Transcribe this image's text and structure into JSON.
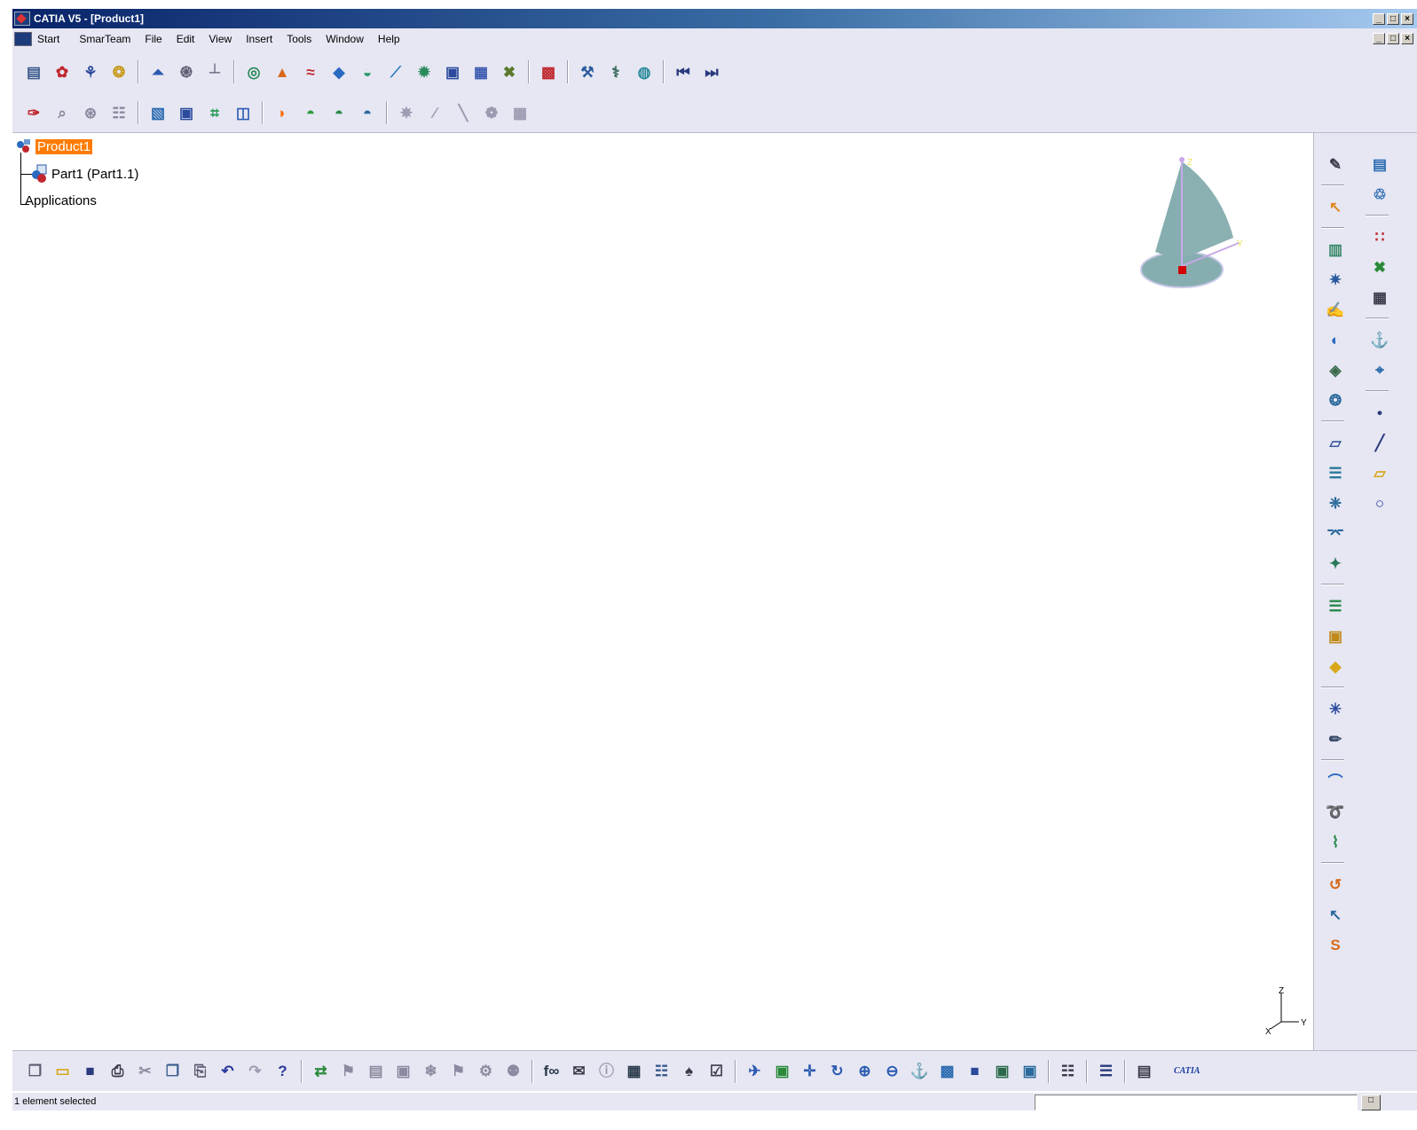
{
  "window": {
    "title": "CATIA V5 - [Product1]",
    "controls": [
      "_",
      "□",
      "×"
    ]
  },
  "menubar": {
    "items": [
      "Start",
      "SmarTeam",
      "File",
      "Edit",
      "View",
      "Insert",
      "Tools",
      "Window",
      "Help"
    ]
  },
  "toolbar_row1": [
    {
      "name": "catalog-icon",
      "glyph": "▤",
      "color": "#3a5a8c"
    },
    {
      "name": "select-all-icon",
      "glyph": "✿",
      "color": "#c0282e"
    },
    {
      "name": "product-icon",
      "glyph": "⚘",
      "color": "#2a4a9c"
    },
    {
      "name": "replace-icon",
      "glyph": "❂",
      "color": "#c89a1a"
    },
    {
      "name": "up-arrow-icon",
      "glyph": "⏶",
      "color": "#2a5ab0"
    },
    {
      "name": "spiral-icon",
      "glyph": "֎",
      "color": "#5a5a70"
    },
    {
      "name": "axis-system-icon",
      "glyph": "┴",
      "color": "#5a5a70"
    },
    {
      "name": "extrude-icon",
      "glyph": "◎",
      "color": "#2a8a5a"
    },
    {
      "name": "revolve-icon",
      "glyph": "▲",
      "color": "#d86a1a"
    },
    {
      "name": "sweep-icon",
      "glyph": "≈",
      "color": "#c0282e"
    },
    {
      "name": "fill-icon",
      "glyph": "◆",
      "color": "#2a6ac0"
    },
    {
      "name": "loft-icon",
      "glyph": "◒",
      "color": "#2a9a6a"
    },
    {
      "name": "blend-icon",
      "glyph": "⟋",
      "color": "#2a7ac0"
    },
    {
      "name": "offset-icon",
      "glyph": "✹",
      "color": "#2a8a5a"
    },
    {
      "name": "join-icon",
      "glyph": "▣",
      "color": "#2a4a9c"
    },
    {
      "name": "split-icon",
      "glyph": "▦",
      "color": "#3a5ab0"
    },
    {
      "name": "trim-icon",
      "glyph": "✖",
      "color": "#5a7a2a"
    },
    {
      "name": "measure-icon",
      "glyph": "▩",
      "color": "#c0282e"
    },
    {
      "name": "analysis-icon",
      "glyph": "⚒",
      "color": "#2a5a9c"
    },
    {
      "name": "knowledge-icon",
      "glyph": "⚕",
      "color": "#3a6a5a"
    },
    {
      "name": "globe-icon",
      "glyph": "◍",
      "color": "#2a8a9a"
    },
    {
      "name": "first-icon",
      "glyph": "⏮",
      "color": "#2a3a7c"
    },
    {
      "name": "last-icon",
      "glyph": "⏭",
      "color": "#2a3a7c"
    }
  ],
  "toolbar_row2": [
    {
      "name": "sketch-icon",
      "glyph": "✑",
      "color": "#c0282e"
    },
    {
      "name": "projection-icon",
      "glyph": "⌕",
      "color": "#8a8aa0"
    },
    {
      "name": "intersection-icon",
      "glyph": "⊛",
      "color": "#8a8aa0"
    },
    {
      "name": "boundary-icon",
      "glyph": "☷",
      "color": "#8a8aa0"
    },
    {
      "name": "view-mode-1-icon",
      "glyph": "▧",
      "color": "#2a6ab0"
    },
    {
      "name": "view-mode-2-icon",
      "glyph": "▣",
      "color": "#2a4a9c"
    },
    {
      "name": "mesh-icon",
      "glyph": "⌗",
      "color": "#2a9a5a"
    },
    {
      "name": "panel-icon",
      "glyph": "◫",
      "color": "#2a5ab0"
    },
    {
      "name": "dome-orange-icon",
      "glyph": "◗",
      "color": "#ff6a00"
    },
    {
      "name": "dome-green-icon",
      "glyph": "◓",
      "color": "#2a9a3a"
    },
    {
      "name": "dome-green-2-icon",
      "glyph": "◓",
      "color": "#2a8a4a"
    },
    {
      "name": "dome-outline-icon",
      "glyph": "◓",
      "color": "#2a6a9a"
    },
    {
      "name": "scatter-icon",
      "glyph": "✵",
      "color": "#9a9ab0"
    },
    {
      "name": "curve-icon",
      "glyph": "∕",
      "color": "#9a9ab0"
    },
    {
      "name": "polyline-icon",
      "glyph": "╲",
      "color": "#9a9ab0"
    },
    {
      "name": "cloud-icon",
      "glyph": "❁",
      "color": "#9a9ab0"
    },
    {
      "name": "grid-icon",
      "glyph": "▦",
      "color": "#9a9ab0"
    }
  ],
  "tree": {
    "root": "Product1",
    "child": "Part1 (Part1.1)",
    "applications": "Applications"
  },
  "compass_labels": {
    "z": "Z",
    "y": "Y"
  },
  "axis_labels": {
    "z": "Z",
    "y": "Y",
    "x": "X"
  },
  "right_col1": [
    {
      "name": "sketcher-icon",
      "glyph": "✎",
      "color": "#3a3a4a"
    },
    {
      "name": "select-icon",
      "glyph": "↖",
      "color": "#e08a1a"
    },
    {
      "name": "wireframe-icon",
      "glyph": "▥",
      "color": "#3a8a6a"
    },
    {
      "name": "surface-patch-icon",
      "glyph": "✷",
      "color": "#2a5a9c"
    },
    {
      "name": "edit-surface-icon",
      "glyph": "✍",
      "color": "#3a7a5a"
    },
    {
      "name": "circle-surface-icon",
      "glyph": "◐",
      "color": "#2a6ac0"
    },
    {
      "name": "shape-icon",
      "glyph": "◈",
      "color": "#3a6a4a"
    },
    {
      "name": "hatch-icon",
      "glyph": "❂",
      "color": "#2a6a9c"
    },
    {
      "name": "plane-tool-icon",
      "glyph": "▱",
      "color": "#3a5a9c"
    },
    {
      "name": "stacked-icon",
      "glyph": "☰",
      "color": "#2a7a9c"
    },
    {
      "name": "deform-icon",
      "glyph": "❈",
      "color": "#2a6a9c"
    },
    {
      "name": "bridge-icon",
      "glyph": "⌤",
      "color": "#2a6a9c"
    },
    {
      "name": "diamond-icon",
      "glyph": "✦",
      "color": "#2a7a5a"
    },
    {
      "name": "layers-icon",
      "glyph": "☰",
      "color": "#2a8a4a"
    },
    {
      "name": "box-icon",
      "glyph": "▣",
      "color": "#c08a1a"
    },
    {
      "name": "gem-icon",
      "glyph": "◆",
      "color": "#d8a81a"
    },
    {
      "name": "spider-icon",
      "glyph": "✳",
      "color": "#2a4a9c"
    },
    {
      "name": "curve-edit-icon",
      "glyph": "✏",
      "color": "#3a4a6a"
    },
    {
      "name": "arc-icon",
      "glyph": "⌒",
      "color": "#2a6ac0"
    },
    {
      "name": "helix-icon",
      "glyph": "➰",
      "color": "#d86a1a"
    },
    {
      "name": "connect-icon",
      "glyph": "⌇",
      "color": "#2a8a4a"
    },
    {
      "name": "spiral-curve-icon",
      "glyph": "↺",
      "color": "#d86a1a"
    },
    {
      "name": "corner-icon",
      "glyph": "↖",
      "color": "#2a6a9c"
    },
    {
      "name": "s-curve-icon",
      "glyph": "S",
      "color": "#d86a1a"
    }
  ],
  "right_col2": [
    {
      "name": "shaded-icon",
      "glyph": "▤",
      "color": "#2a6ab0"
    },
    {
      "name": "rotate-icon",
      "glyph": "♲",
      "color": "#2a6ab0"
    },
    {
      "name": "points-grid-icon",
      "glyph": "∷",
      "color": "#c0282e"
    },
    {
      "name": "explode-icon",
      "glyph": "✖",
      "color": "#2a8a3a"
    },
    {
      "name": "table-icon",
      "glyph": "▦",
      "color": "#3a3a4a"
    },
    {
      "name": "symmetry-icon",
      "glyph": "⚓",
      "color": "#2a8a9a"
    },
    {
      "name": "compass-tool-icon",
      "glyph": "⌖",
      "color": "#2a6ab0"
    },
    {
      "name": "point-icon",
      "glyph": "•",
      "color": "#2a3a7c"
    },
    {
      "name": "line-icon",
      "glyph": "╱",
      "color": "#2a3a7c"
    },
    {
      "name": "plane-icon",
      "glyph": "▱",
      "color": "#d8a81a"
    },
    {
      "name": "circle-icon",
      "glyph": "○",
      "color": "#2a3a9c"
    }
  ],
  "bottom_toolbar": [
    {
      "name": "new-icon",
      "glyph": "❐",
      "color": "#5a5a70"
    },
    {
      "name": "open-icon",
      "glyph": "▭",
      "color": "#d8a81a"
    },
    {
      "name": "save-icon",
      "glyph": "■",
      "color": "#2a3a7c"
    },
    {
      "name": "print-icon",
      "glyph": "⎙",
      "color": "#3a3a4a"
    },
    {
      "name": "cut-icon",
      "glyph": "✂",
      "color": "#8a8aa0"
    },
    {
      "name": "copy-icon",
      "glyph": "❐",
      "color": "#3a5a8c"
    },
    {
      "name": "paste-icon",
      "glyph": "⎘",
      "color": "#5a5a70"
    },
    {
      "name": "undo-icon",
      "glyph": "↶",
      "color": "#2a3a9c"
    },
    {
      "name": "redo-icon",
      "glyph": "↷",
      "color": "#9a9ab0"
    },
    {
      "name": "whats-this-icon",
      "glyph": "?",
      "color": "#2a3a9c"
    },
    {
      "name": "update-icon",
      "glyph": "⇄",
      "color": "#2a8a3a"
    },
    {
      "name": "instantiate-icon",
      "glyph": "⚑",
      "color": "#8a8aa0"
    },
    {
      "name": "catalog-browser-icon",
      "glyph": "▤",
      "color": "#8a8aa0"
    },
    {
      "name": "replace-tool-icon",
      "glyph": "▣",
      "color": "#8a8aa0"
    },
    {
      "name": "copy-object-icon",
      "glyph": "❄",
      "color": "#8a8aa0"
    },
    {
      "name": "part-design-icon",
      "glyph": "⚑",
      "color": "#8a8aa0"
    },
    {
      "name": "settings-icon",
      "glyph": "⚙",
      "color": "#8a8aa0"
    },
    {
      "name": "tree-icon",
      "glyph": "⚉",
      "color": "#8a8aa0"
    },
    {
      "name": "formula-icon",
      "glyph": "f∞",
      "color": "#2a3a4a"
    },
    {
      "name": "comment-icon",
      "glyph": "✉",
      "color": "#3a3a4a"
    },
    {
      "name": "info-icon",
      "glyph": "ⓘ",
      "color": "#9a9ab0"
    },
    {
      "name": "table-tool-icon",
      "glyph": "▦",
      "color": "#2a3a4a"
    },
    {
      "name": "hierarchy-icon",
      "glyph": "☷",
      "color": "#3a5a8c"
    },
    {
      "name": "rule-icon",
      "glyph": "♠",
      "color": "#3a3a4a"
    },
    {
      "name": "check-icon",
      "glyph": "☑",
      "color": "#3a3a4a"
    },
    {
      "name": "fly-icon",
      "glyph": "✈",
      "color": "#2a5ab0"
    },
    {
      "name": "fit-all-icon",
      "glyph": "▣",
      "color": "#2a8a3a"
    },
    {
      "name": "pan-icon",
      "glyph": "✛",
      "color": "#2a5ab0"
    },
    {
      "name": "rotate-view-icon",
      "glyph": "↻",
      "color": "#2a5ab0"
    },
    {
      "name": "zoom-in-icon",
      "glyph": "⊕",
      "color": "#2a5ab0"
    },
    {
      "name": "zoom-out-icon",
      "glyph": "⊖",
      "color": "#2a5ab0"
    },
    {
      "name": "normal-view-icon",
      "glyph": "⚓",
      "color": "#2a6ab0"
    },
    {
      "name": "views-icon",
      "glyph": "▩",
      "color": "#2a6ab0"
    },
    {
      "name": "render-style-icon",
      "glyph": "■",
      "color": "#2a4a9c"
    },
    {
      "name": "hide-show-icon",
      "glyph": "▣",
      "color": "#2a6a4a"
    },
    {
      "name": "swap-space-icon",
      "glyph": "▣",
      "color": "#2a6a9c"
    },
    {
      "name": "tools-palette-icon",
      "glyph": "☷",
      "color": "#3a3a4a"
    },
    {
      "name": "compass-bar-icon",
      "glyph": "☰",
      "color": "#2a3a7c"
    },
    {
      "name": "multi-view-icon",
      "glyph": "▤",
      "color": "#3a3a4a"
    }
  ],
  "catia_logo": "CATIA",
  "status": {
    "message": "1 element selected",
    "cmd_button": "□"
  }
}
